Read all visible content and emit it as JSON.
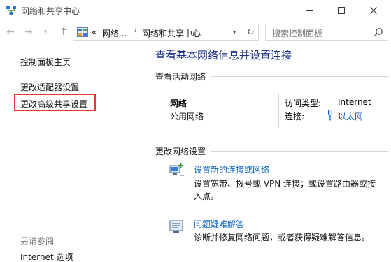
{
  "window": {
    "title": "网络和共享中心"
  },
  "nav": {
    "breadcrumb_prefix": "«",
    "breadcrumb_1": "网络...",
    "breadcrumb_sep": "›",
    "breadcrumb_2": "网络和共享中心",
    "search_placeholder": "搜索控制面板"
  },
  "sidebar": {
    "items": [
      {
        "label": "控制面板主页"
      },
      {
        "label": "更改适配器设置"
      },
      {
        "label": "更改高级共享设置"
      }
    ],
    "see_also_title": "另请参阅",
    "see_also_items": [
      {
        "label": "Internet 选项"
      }
    ]
  },
  "main": {
    "title": "查看基本网络信息并设置连接",
    "active_networks_heading": "查看活动网络",
    "network": {
      "name": "网络",
      "type": "公用网络",
      "access_type_label": "访问类型:",
      "access_type_value": "Internet",
      "connection_label": "连接:",
      "connection_value": "以太网"
    },
    "change_settings_heading": "更改网络设置",
    "tasks": [
      {
        "link": "设置新的连接或网络",
        "desc": "设置宽带、拨号或 VPN 连接；或设置路由器或接入点。",
        "icon": "new-connection-icon"
      },
      {
        "link": "问题疑难解答",
        "desc": "诊断并修复网络问题，或者获得疑难解答信息。",
        "icon": "troubleshoot-icon"
      }
    ]
  },
  "colors": {
    "title_blue": "#1e3287",
    "link_blue": "#0b63c5",
    "highlight_red": "#e23b2e"
  }
}
